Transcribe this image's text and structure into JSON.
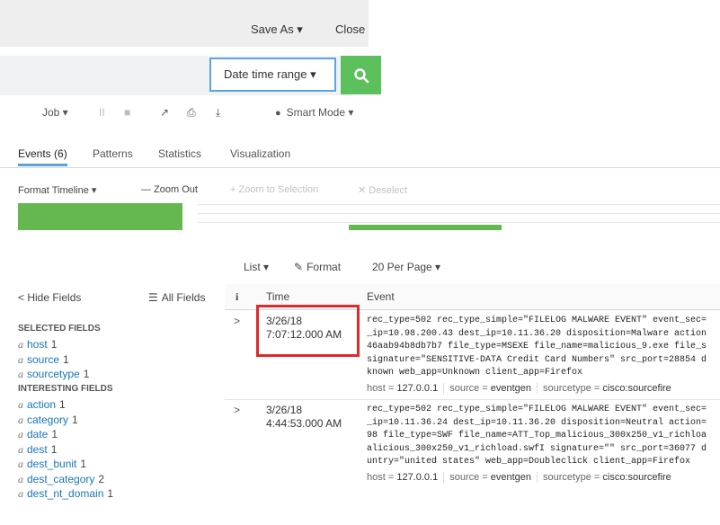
{
  "header": {
    "save_as": "Save As ▾",
    "close": "Close"
  },
  "search": {
    "date_range": "Date time range ▾"
  },
  "job_toolbar": {
    "job": "Job ▾",
    "pause": "II",
    "stop": "■",
    "share": "↗",
    "print": "⎙",
    "export": "⤓",
    "mode": "Smart Mode ▾"
  },
  "tabs": [
    {
      "label": "Events (6)"
    },
    {
      "label": "Patterns"
    },
    {
      "label": "Statistics"
    },
    {
      "label": "Visualization"
    }
  ],
  "timeline": {
    "format": "Format Timeline ▾",
    "zoom_out": "— Zoom Out",
    "zoom_sel": "+ Zoom to Selection",
    "deselect": "✕ Deselect",
    "bars": [
      1.0,
      0.2
    ]
  },
  "list_controls": {
    "list": "List ▾",
    "format": "Format",
    "per_page": "20 Per Page ▾"
  },
  "fields": {
    "hide": "< Hide Fields",
    "all": "All Fields",
    "selected_title": "SELECTED FIELDS",
    "selected": [
      {
        "name": "host",
        "count": "1"
      },
      {
        "name": "source",
        "count": "1"
      },
      {
        "name": "sourcetype",
        "count": "1"
      }
    ],
    "interesting_title": "INTERESTING FIELDS",
    "interesting": [
      {
        "name": "action",
        "count": "1"
      },
      {
        "name": "category",
        "count": "1"
      },
      {
        "name": "date",
        "count": "1"
      },
      {
        "name": "dest",
        "count": "1"
      },
      {
        "name": "dest_bunit",
        "count": "1"
      },
      {
        "name": "dest_category",
        "count": "2"
      },
      {
        "name": "dest_nt_domain",
        "count": "1"
      }
    ]
  },
  "table": {
    "col_i": "i",
    "col_time": "Time",
    "col_event": "Event"
  },
  "events": [
    {
      "date": "3/26/18",
      "time": "7:07:12.000 AM",
      "lines": [
        "rec_type=502 rec_type_simple=\"FILELOG MALWARE EVENT\" event_sec=",
        "_ip=10.98.200.43 dest_ip=10.11.36.20 disposition=Malware action",
        "46aab94b8db7b7 file_type=MSEXE file_name=malicious_9.exe file_s",
        "signature=\"SENSITIVE-DATA Credit Card Numbers\" src_port=28854 d",
        "known web_app=Unknown client_app=Firefox"
      ],
      "host": "127.0.0.1",
      "source": "eventgen",
      "sourcetype": "cisco:sourcefire"
    },
    {
      "date": "3/26/18",
      "time": "4:44:53.000 AM",
      "lines": [
        "rec_type=502 rec_type_simple=\"FILELOG MALWARE EVENT\" event_sec=",
        "_ip=10.11.36.24 dest_ip=10.11.36.20 disposition=Neutral action=",
        "98 file_type=SWF file_name=ATT_Top_malicious_300x250_v1_richloa",
        "alicious_300x250_v1_richload.swfI signature=\"\" src_port=36077 d",
        "untry=\"united states\" web_app=Doubleclick client_app=Firefox"
      ],
      "host": "127.0.0.1",
      "source": "eventgen",
      "sourcetype": "cisco:sourcefire"
    }
  ],
  "meta_keys": {
    "host": "host =",
    "source": "source =",
    "sourcetype": "sourcetype ="
  }
}
